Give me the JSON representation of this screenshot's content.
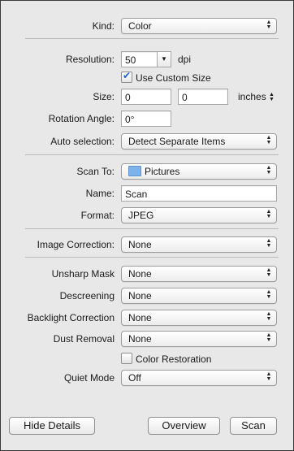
{
  "kind": {
    "label": "Kind:",
    "value": "Color"
  },
  "resolution": {
    "label": "Resolution:",
    "value": "50",
    "unit": "dpi"
  },
  "custom_size": {
    "label": "Use Custom Size",
    "checked": true
  },
  "size": {
    "label": "Size:",
    "width": "0",
    "height": "0",
    "unit": "inches"
  },
  "rotation": {
    "label": "Rotation Angle:",
    "value": "0°"
  },
  "auto_selection": {
    "label": "Auto selection:",
    "value": "Detect Separate Items"
  },
  "scan_to": {
    "label": "Scan To:",
    "value": "Pictures"
  },
  "name": {
    "label": "Name:",
    "value": "Scan"
  },
  "format": {
    "label": "Format:",
    "value": "JPEG"
  },
  "image_correction": {
    "label": "Image Correction:",
    "value": "None"
  },
  "unsharp_mask": {
    "label": "Unsharp Mask",
    "value": "None"
  },
  "descreening": {
    "label": "Descreening",
    "value": "None"
  },
  "backlight": {
    "label": "Backlight Correction",
    "value": "None"
  },
  "dust_removal": {
    "label": "Dust Removal",
    "value": "None"
  },
  "color_restoration": {
    "label": "Color Restoration",
    "checked": false
  },
  "quiet_mode": {
    "label": "Quiet Mode",
    "value": "Off"
  },
  "buttons": {
    "hide_details": "Hide Details",
    "overview": "Overview",
    "scan": "Scan"
  }
}
